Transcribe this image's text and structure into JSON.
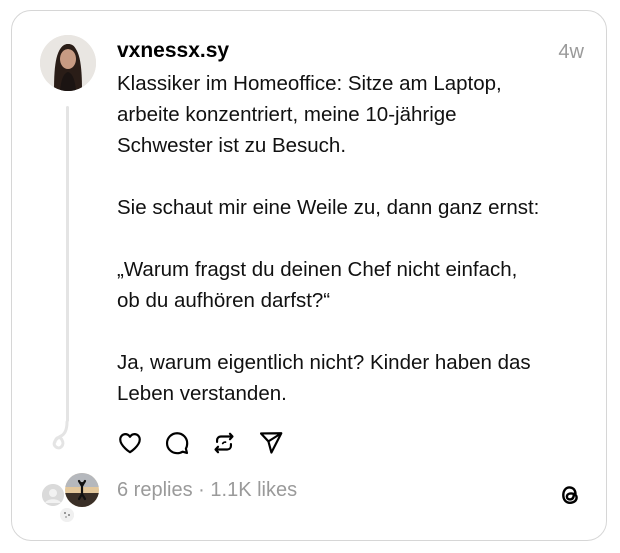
{
  "post": {
    "username": "vxnessx.sy",
    "timestamp": "4w",
    "paragraphs": [
      [
        "Klassiker im Homeoffice: Sitze am Laptop,",
        "arbeite konzentriert, meine 10-jährige",
        "Schwester ist zu Besuch."
      ],
      [
        "Sie schaut mir eine Weile zu, dann ganz ernst:"
      ],
      [
        "„Warum fragst du deinen Chef nicht einfach,",
        "ob du aufhören darfst?“"
      ],
      [
        "Ja, warum eigentlich nicht? Kinder haben das",
        "Leben verstanden."
      ]
    ]
  },
  "actions": {
    "like_icon": "heart-icon",
    "comment_icon": "comment-bubble-icon",
    "repost_icon": "repost-icon",
    "share_icon": "send-icon"
  },
  "stats": {
    "replies": "6 replies",
    "separator": " · ",
    "likes": "1.1K likes"
  },
  "branding": {
    "logo_icon": "threads-logo-icon"
  },
  "colors": {
    "border": "#d6d6d6",
    "muted_text": "#9a9a9a",
    "thread_line": "#e4e4e4"
  }
}
